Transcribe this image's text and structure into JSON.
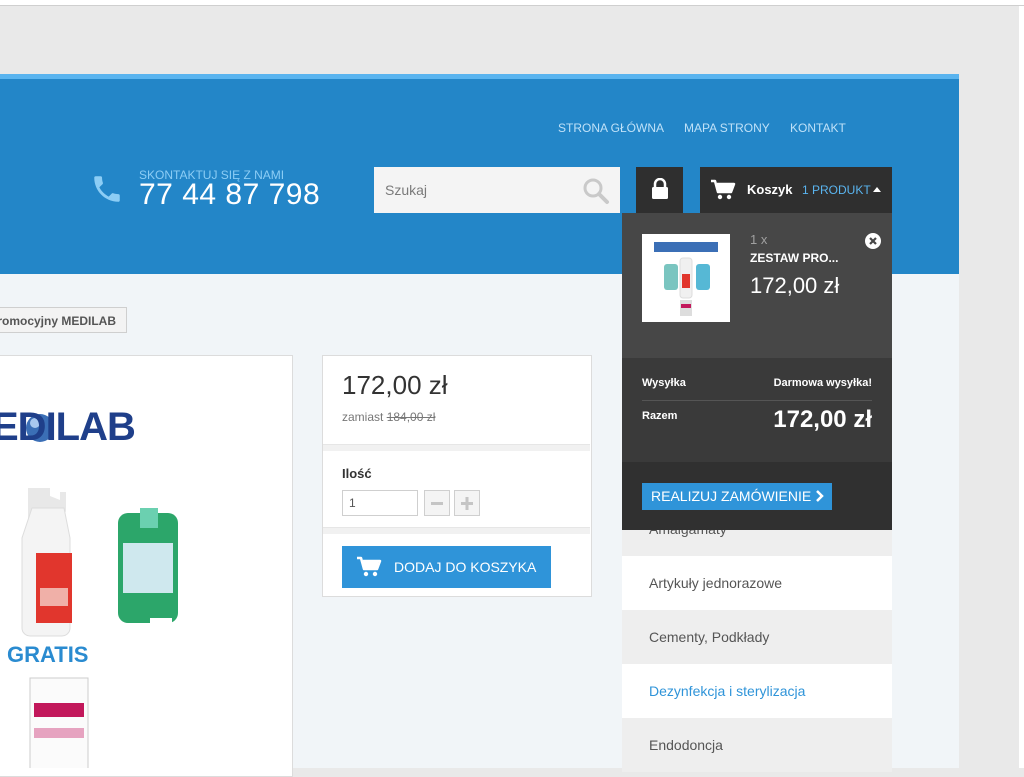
{
  "header": {
    "nav": [
      "STRONA GŁÓWNA",
      "MAPA STRONY",
      "KONTAKT"
    ],
    "contact_label": "SKONTAKTUJ SIĘ Z NAMI",
    "phone": "77 44 87 798",
    "search_placeholder": "Szukaj",
    "cart_label": "Koszyk",
    "cart_count": "1 PRODUKT"
  },
  "breadcrumb": "romocyjny MEDILAB",
  "product_image": {
    "logo_text": "EDILAB",
    "gratis_text": "GRATIS"
  },
  "product": {
    "price": "172,00 zł",
    "old_price_prefix": "zamiast",
    "old_price": "184,00 zł",
    "qty_label": "Ilość",
    "qty_value": "1",
    "add_to_cart": "DODAJ DO KOSZYKA"
  },
  "cart_dropdown": {
    "item_qty": "1 x",
    "item_name": "ZESTAW PRO...",
    "item_price": "172,00 zł",
    "shipping_label": "Wysyłka",
    "shipping_value": "Darmowa wysyłka!",
    "total_label": "Razem",
    "total_value": "172,00 zł",
    "checkout": "REALIZUJ ZAMÓWIENIE"
  },
  "categories": [
    {
      "label": "Amalgamaty"
    },
    {
      "label": "Artykuły jednorazowe"
    },
    {
      "label": "Cementy, Podkłady"
    },
    {
      "label": "Dezynfekcja i sterylizacja"
    },
    {
      "label": "Endodoncja"
    }
  ],
  "colors": {
    "header_blue": "#2386c8",
    "accent_blue": "#2f94d9",
    "dark": "#2f2f2f"
  }
}
